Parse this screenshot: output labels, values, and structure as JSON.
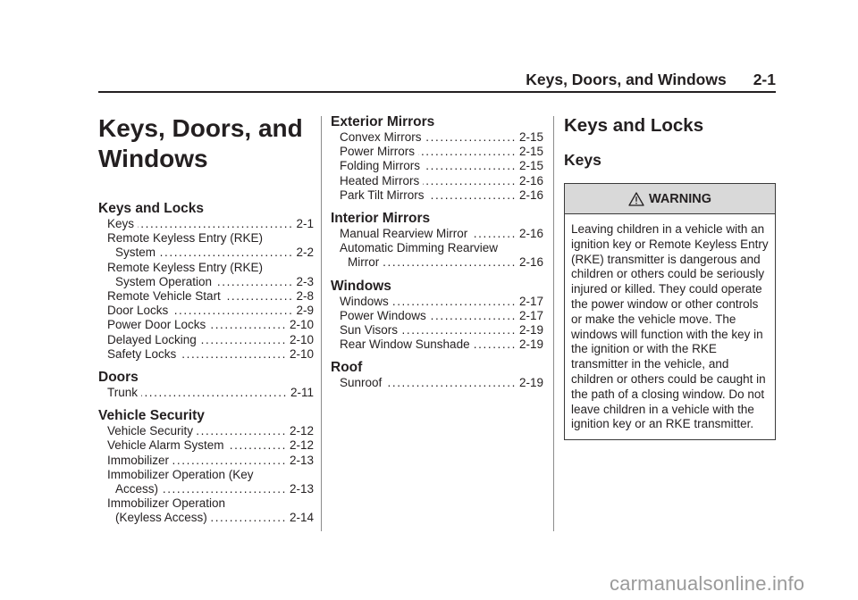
{
  "running_head": {
    "title": "Keys, Doors, and Windows",
    "page_number": "2-1"
  },
  "chapter_title_line1": "Keys, Doors, and",
  "chapter_title_line2": "Windows",
  "toc": {
    "keys_and_locks": {
      "title": "Keys and Locks",
      "entries": [
        {
          "label": "Keys",
          "page": "2-1"
        },
        {
          "label_line1": "Remote Keyless Entry (RKE)",
          "label": "System",
          "page": "2-2"
        },
        {
          "label_line1": "Remote Keyless Entry (RKE)",
          "label": "System Operation",
          "page": "2-3"
        },
        {
          "label": "Remote Vehicle Start",
          "page": "2-8"
        },
        {
          "label": "Door Locks",
          "page": "2-9"
        },
        {
          "label": "Power Door Locks",
          "page": "2-10"
        },
        {
          "label": "Delayed Locking",
          "page": "2-10"
        },
        {
          "label": "Safety Locks",
          "page": "2-10"
        }
      ]
    },
    "doors": {
      "title": "Doors",
      "entries": [
        {
          "label": "Trunk",
          "page": "2-11"
        }
      ]
    },
    "vehicle_security": {
      "title": "Vehicle Security",
      "entries": [
        {
          "label": "Vehicle Security",
          "page": "2-12"
        },
        {
          "label": "Vehicle Alarm System",
          "page": "2-12"
        },
        {
          "label": "Immobilizer",
          "page": "2-13"
        },
        {
          "label_line1": "Immobilizer Operation (Key",
          "label": "Access)",
          "page": "2-13"
        },
        {
          "label_line1": "Immobilizer Operation",
          "label": "(Keyless Access)",
          "page": "2-14"
        }
      ]
    },
    "exterior_mirrors": {
      "title": "Exterior Mirrors",
      "entries": [
        {
          "label": "Convex Mirrors",
          "page": "2-15"
        },
        {
          "label": "Power Mirrors",
          "page": "2-15"
        },
        {
          "label": "Folding Mirrors",
          "page": "2-15"
        },
        {
          "label": "Heated Mirrors",
          "page": "2-16"
        },
        {
          "label": "Park Tilt Mirrors",
          "page": "2-16"
        }
      ]
    },
    "interior_mirrors": {
      "title": "Interior Mirrors",
      "entries": [
        {
          "label": "Manual Rearview Mirror",
          "page": "2-16"
        },
        {
          "label_line1": "Automatic Dimming Rearview",
          "label": "Mirror",
          "page": "2-16"
        }
      ]
    },
    "windows": {
      "title": "Windows",
      "entries": [
        {
          "label": "Windows",
          "page": "2-17"
        },
        {
          "label": "Power Windows",
          "page": "2-17"
        },
        {
          "label": "Sun Visors",
          "page": "2-19"
        },
        {
          "label": "Rear Window Sunshade",
          "page": "2-19"
        }
      ]
    },
    "roof": {
      "title": "Roof",
      "entries": [
        {
          "label": "Sunroof",
          "page": "2-19"
        }
      ]
    }
  },
  "content": {
    "heading": "Keys and Locks",
    "subheading": "Keys",
    "warning": {
      "icon": "warning-triangle-icon",
      "title": "WARNING",
      "text": "Leaving children in a vehicle with an ignition key or Remote Keyless Entry (RKE) transmitter is dangerous and children or others could be seriously injured or killed. They could operate the power window or other controls or make the vehicle move. The windows will function with the key in the ignition or with the RKE transmitter in the vehicle, and children or others could be caught in the path of a closing window. Do not leave children in a vehicle with the ignition key or an RKE transmitter."
    }
  },
  "watermark": "carmanualsonline.info",
  "colors": {
    "text": "#231f20",
    "warning_header_bg": "#d9d9d9",
    "divider": "#8c8c8c",
    "watermark": "#9a9a9a"
  }
}
